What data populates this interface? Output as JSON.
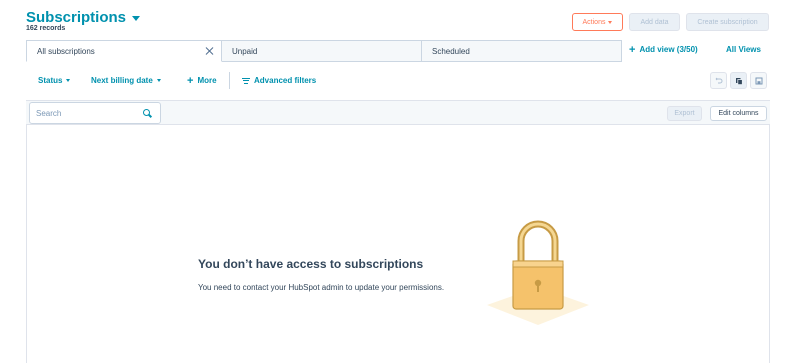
{
  "header": {
    "title": "Subscriptions",
    "records": "162 records",
    "actions_label": "Actions",
    "add_data_label": "Add data",
    "create_label": "Create subscription"
  },
  "tabs": [
    {
      "label": "All subscriptions",
      "active": true
    },
    {
      "label": "Unpaid",
      "active": false
    },
    {
      "label": "Scheduled",
      "active": false
    }
  ],
  "views": {
    "add_view_label": "Add view (3/50)",
    "all_views_label": "All Views"
  },
  "filters": {
    "status_label": "Status",
    "billing_label": "Next billing date",
    "more_label": "More",
    "advanced_label": "Advanced filters"
  },
  "toolbar": {
    "search_placeholder": "Search",
    "export_label": "Export",
    "edit_columns_label": "Edit columns"
  },
  "empty_state": {
    "title": "You don’t have access to subscriptions",
    "description": "You need to contact your HubSpot admin to update your permissions."
  },
  "icons": {
    "undo": "undo-icon",
    "copy": "copy-icon",
    "save": "save-icon",
    "lock": "lock-icon"
  },
  "colors": {
    "accent": "#0091ae",
    "actions": "#ff7a59",
    "lock_body": "#f5c26b"
  }
}
